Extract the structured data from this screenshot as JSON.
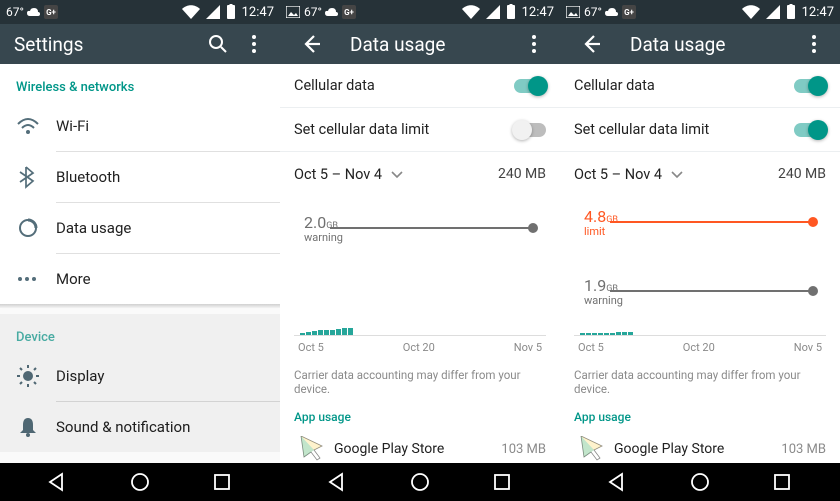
{
  "status": {
    "temp": "67°",
    "time": "12:47"
  },
  "screen1": {
    "title": "Settings",
    "section_wireless": "Wireless & networks",
    "wifi": "Wi-Fi",
    "bluetooth": "Bluetooth",
    "data_usage": "Data usage",
    "more": "More",
    "section_device": "Device",
    "display": "Display",
    "sound": "Sound & notification"
  },
  "screen2": {
    "title": "Data usage",
    "cellular_label": "Cellular data",
    "cellular_on": true,
    "limit_label": "Set cellular data limit",
    "limit_on": false,
    "range": "Oct 5 – Nov 4",
    "total": "240 MB",
    "note": "Carrier data accounting may differ from your device.",
    "app_usage_label": "App usage",
    "app1_name": "Google Play Store",
    "app1_mb": "103 MB"
  },
  "screen3": {
    "title": "Data usage",
    "cellular_label": "Cellular data",
    "cellular_on": true,
    "limit_label": "Set cellular data limit",
    "limit_on": true,
    "range": "Oct 5 – Nov 4",
    "total": "240 MB",
    "note": "Carrier data accounting may differ from your device.",
    "app_usage_label": "App usage",
    "app1_name": "Google Play Store",
    "app1_mb": "103 MB"
  },
  "chart_data": [
    {
      "type": "area",
      "screen": 2,
      "markers": [
        {
          "value": 2.0,
          "unit": "GB",
          "label": "warning",
          "color": "#707070"
        }
      ],
      "x_ticks": [
        "Oct 5",
        "Oct 20",
        "Nov 5"
      ],
      "y_range_gb": [
        0,
        2.2
      ],
      "bars_mb": [
        30,
        55,
        70,
        80,
        95,
        95,
        110,
        115,
        120
      ]
    },
    {
      "type": "area",
      "screen": 3,
      "markers": [
        {
          "value": 4.8,
          "unit": "GB",
          "label": "limit",
          "color": "#ff5722"
        },
        {
          "value": 1.9,
          "unit": "GB",
          "label": "warning",
          "color": "#707070"
        }
      ],
      "x_ticks": [
        "Oct 5",
        "Oct 20",
        "Nov 5"
      ],
      "y_range_gb": [
        0,
        5.0
      ],
      "bars_mb": [
        30,
        55,
        70,
        80,
        95,
        95,
        110,
        115,
        120
      ]
    }
  ]
}
